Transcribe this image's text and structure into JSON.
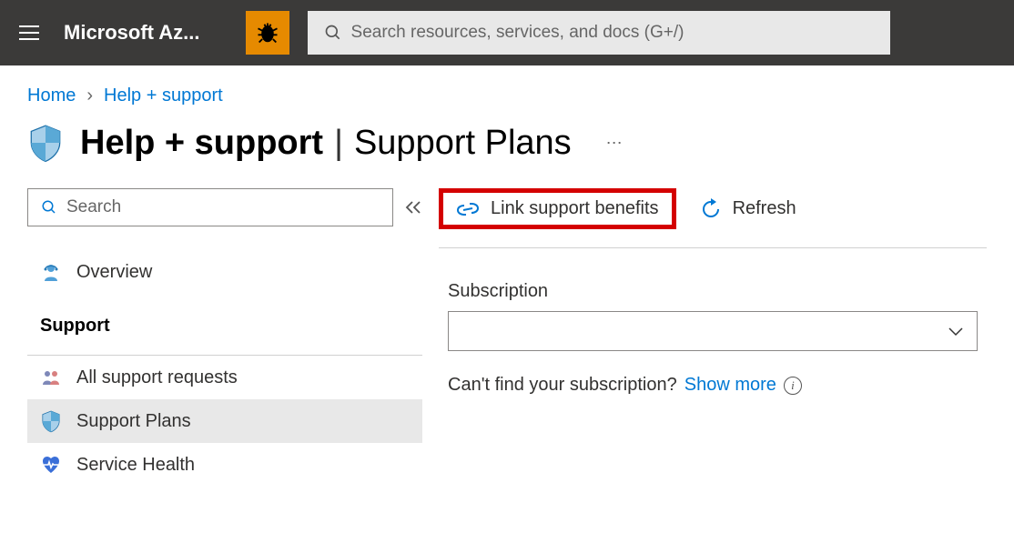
{
  "topbar": {
    "brand": "Microsoft Az...",
    "search_placeholder": "Search resources, services, and docs (G+/)"
  },
  "breadcrumbs": {
    "items": [
      {
        "label": "Home"
      },
      {
        "label": "Help + support"
      }
    ]
  },
  "page": {
    "title_service": "Help + support",
    "title_page": "Support Plans"
  },
  "sidebar": {
    "search_placeholder": "Search",
    "overview_label": "Overview",
    "section_title": "Support",
    "items": [
      {
        "label": "All support requests"
      },
      {
        "label": "Support Plans"
      },
      {
        "label": "Service Health"
      }
    ]
  },
  "toolbar": {
    "link_benefits_label": "Link support benefits",
    "refresh_label": "Refresh"
  },
  "form": {
    "subscription_label": "Subscription",
    "cant_find_text": "Can't find your subscription? ",
    "show_more_label": "Show more"
  }
}
